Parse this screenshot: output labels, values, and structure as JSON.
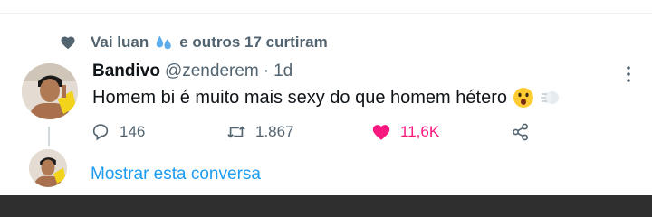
{
  "social_context": {
    "icon": "heart-icon",
    "prefix": "Vai luan",
    "emoji": "sweat-droplets-icon",
    "suffix": "e outros 17 curtiram"
  },
  "tweet": {
    "display_name": "Bandivo",
    "handle": "@zenderem",
    "separator": "·",
    "time": "1d",
    "text": "Homem bi é muito mais sexy do que homem hétero",
    "emojis": [
      "astonished-face-icon",
      "dashing-away-icon"
    ],
    "replies": "146",
    "retweets": "1.867",
    "likes": "11,6K",
    "liked": true
  },
  "show_thread": "Mostrar esta conversa",
  "colors": {
    "like": "#f91880",
    "link": "#1d9bf0",
    "secondary_text": "#536471"
  }
}
